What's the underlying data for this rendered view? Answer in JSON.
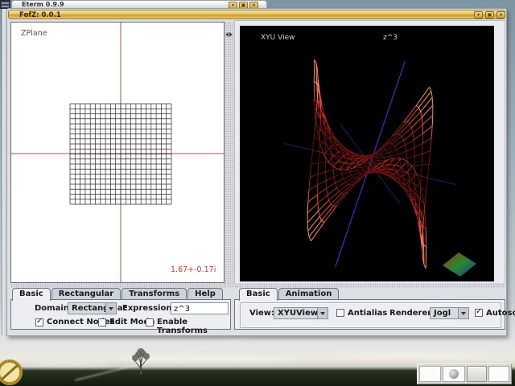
{
  "eterm_window": {
    "title": "Eterm 0.9.9"
  },
  "app_window": {
    "title": "FofZ: 0.0.1",
    "left": {
      "canvas_label": "ZPlane",
      "cursor_readout": "1.67+-0.17i",
      "tabs": [
        "Basic",
        "Rectangular",
        "Transforms",
        "Help"
      ],
      "selected_tab": "Basic",
      "domain_label": "Domain:",
      "domain_value": "Rectangular",
      "expression_label": "Expression:",
      "expression_value": "z^3",
      "checkboxes": [
        {
          "label": "Connect Nodes",
          "checked": true
        },
        {
          "label": "Edit Mode",
          "checked": false
        },
        {
          "label": "Enable Transforms",
          "checked": false
        }
      ]
    },
    "right": {
      "canvas_label": "XYU View",
      "canvas_title": "z^3",
      "tabs": [
        "Basic",
        "Animation"
      ],
      "selected_tab": "Basic",
      "view_label": "View:",
      "view_value": "XYUView",
      "antialias_label": "Antialias",
      "antialias_checked": false,
      "renderer_label": "Renderer:",
      "renderer_value": "Jogl",
      "autoscale_label": "Autoscale",
      "autoscale_checked": true
    }
  },
  "colors": {
    "titlebar_gold": "#e7c35f",
    "mesh_red": "#c62a18",
    "crosshair_red": "#b34b4b",
    "readout_red": "#c23a35",
    "axis_blue": "#3b3bd0",
    "canvas_black": "#000000"
  }
}
